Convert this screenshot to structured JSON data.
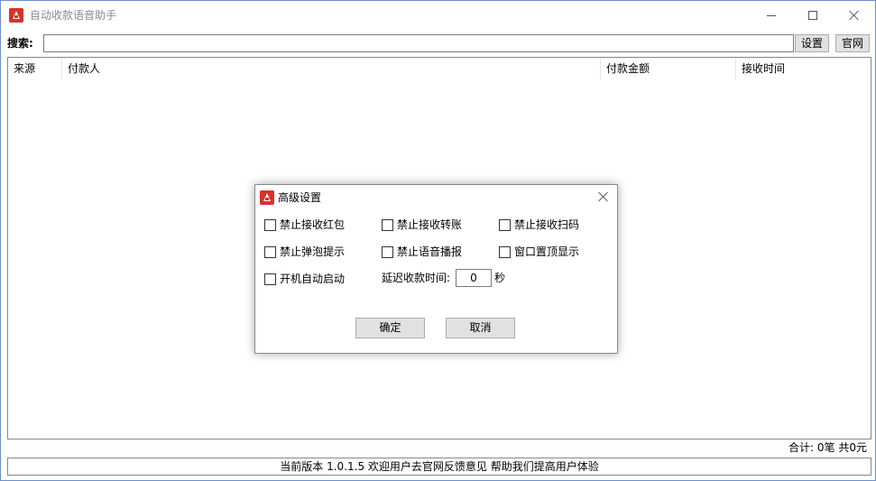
{
  "window": {
    "title": "自动收款语音助手"
  },
  "search": {
    "label": "搜索:",
    "value": "",
    "placeholder": ""
  },
  "toolbar": {
    "settings_label": "设置",
    "website_label": "官网"
  },
  "table": {
    "columns": [
      "来源",
      "付款人",
      "付款金额",
      "接收时间"
    ],
    "rows": []
  },
  "footer": {
    "total": "合计: 0笔 共0元",
    "status": "当前版本 1.0.1.5 欢迎用户去官网反馈意见 帮助我们提高用户体验"
  },
  "dialog": {
    "title": "高级设置",
    "options": [
      {
        "label": "禁止接收红包",
        "checked": false
      },
      {
        "label": "禁止接收转账",
        "checked": false
      },
      {
        "label": "禁止接收扫码",
        "checked": false
      },
      {
        "label": "禁止弹泡提示",
        "checked": false
      },
      {
        "label": "禁止语音播报",
        "checked": false
      },
      {
        "label": "窗口置顶显示",
        "checked": false
      },
      {
        "label": "开机自动启动",
        "checked": false
      }
    ],
    "delay_label": "延迟收款时间:",
    "delay_value": "0",
    "delay_unit": "秒",
    "ok_label": "确定",
    "cancel_label": "取消"
  },
  "colors": {
    "icon_red": "#d8322b",
    "window_border": "#6d8fc7",
    "button_bg": "#e1e1e1"
  }
}
